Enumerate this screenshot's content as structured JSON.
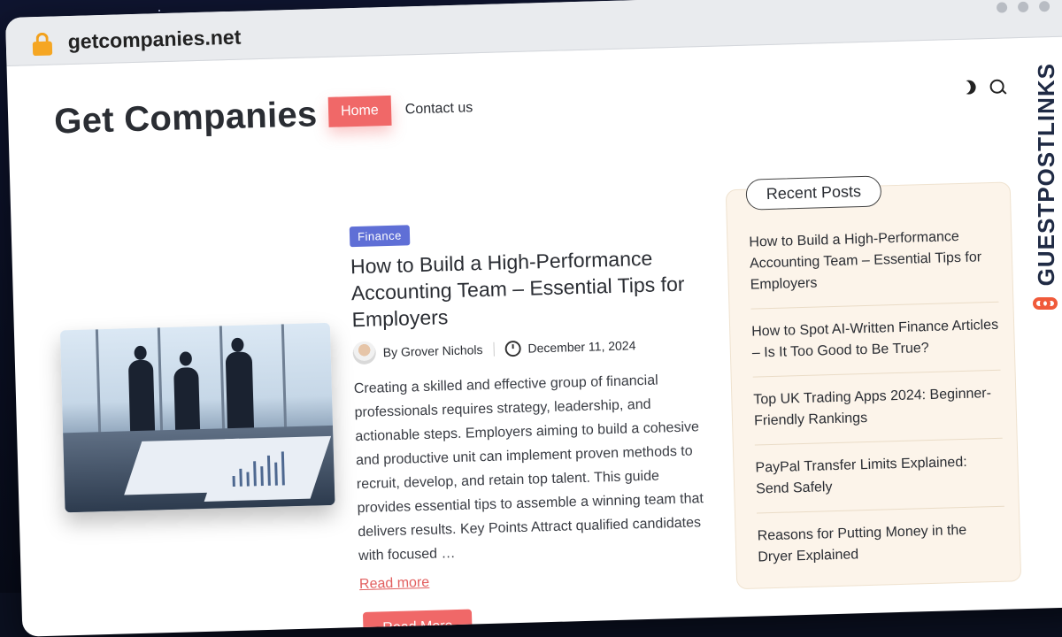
{
  "browser": {
    "url": "getcompanies.net"
  },
  "site": {
    "logo": "Get Companies",
    "nav": [
      {
        "label": "Home"
      },
      {
        "label": "Contact us"
      }
    ]
  },
  "post": {
    "category": "Finance",
    "title": "How to Build a High-Performance Accounting Team – Essential Tips for Employers",
    "author": "By Grover Nichols",
    "date": "December 11, 2024",
    "excerpt": "Creating a skilled and effective group of financial professionals requires strategy, leadership, and actionable steps. Employers aiming to build a cohesive and productive unit can implement proven methods to recruit, develop, and retain top talent. This guide provides essential tips to assemble a winning team that delivers results. Key Points Attract qualified candidates with focused …",
    "read_more_link": "Read more",
    "read_more_button": "Read More"
  },
  "sidebar": {
    "title": "Recent Posts",
    "items": [
      {
        "label": "How to Build a High-Performance Accounting Team – Essential Tips for Employers"
      },
      {
        "label": "How to Spot AI-Written Finance Articles – Is It Too Good to Be True?"
      },
      {
        "label": "Top UK Trading Apps 2024: Beginner-Friendly Rankings"
      },
      {
        "label": "PayPal Transfer Limits Explained: Send Safely"
      },
      {
        "label": "Reasons for Putting Money in the Dryer Explained"
      }
    ]
  },
  "overlay": {
    "brand": "GUESTPOSTLINKS"
  },
  "colors": {
    "accent": "#f06868",
    "category": "#5f6fd6",
    "sidebar_bg": "#fcf4ea"
  }
}
